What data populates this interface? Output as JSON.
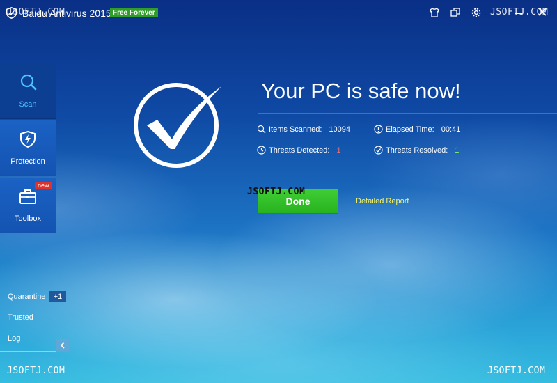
{
  "titlebar": {
    "app_title": "Baidu Antivirus 2015",
    "badge": "Free Forever",
    "icons": [
      "logo-icon",
      "skin-icon",
      "restore-icon",
      "settings-icon",
      "minimize-icon",
      "close-icon"
    ]
  },
  "watermark": "JSOFTJ.COM",
  "sidebar": {
    "items": [
      {
        "label": "Scan",
        "icon": "magnifier-icon",
        "active": true
      },
      {
        "label": "Protection",
        "icon": "shield-bolt-icon",
        "active": false
      },
      {
        "label": "Toolbox",
        "icon": "toolbox-icon",
        "active": false,
        "badge": "new"
      }
    ],
    "links": [
      {
        "label": "Quarantine",
        "badge": "+1"
      },
      {
        "label": "Trusted"
      },
      {
        "label": "Log"
      }
    ]
  },
  "result": {
    "headline": "Your PC is safe now!",
    "stats": {
      "items_scanned": {
        "label": "Items Scanned:",
        "value": "10094"
      },
      "elapsed_time": {
        "label": "Elapsed Time:",
        "value": "00:41"
      },
      "threats_detected": {
        "label": "Threats Detected:",
        "value": "1"
      },
      "threats_resolved": {
        "label": "Threats Resolved:",
        "value": "1"
      }
    },
    "done_label": "Done",
    "report_label": "Detailed Report"
  },
  "colors": {
    "accent_blue": "#4fc2ff",
    "done_green": "#2fbd26",
    "report_yellow": "#f4f46a",
    "threat_red": "#ff6a6a",
    "resolved_green": "#7dff6b",
    "badge_green": "#2e9d2a",
    "new_red": "#e0322d"
  }
}
